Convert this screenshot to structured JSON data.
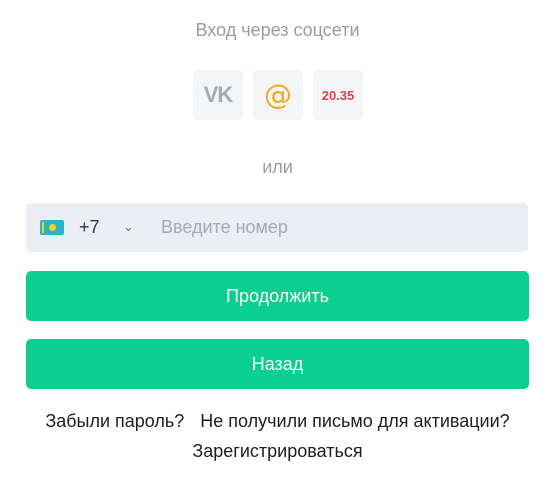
{
  "social": {
    "title": "Вход через соцсети",
    "buttons": [
      {
        "icon": "vk-icon",
        "label": "VK",
        "color": "#a4a9b3"
      },
      {
        "icon": "mail-at-icon",
        "label": "@",
        "color": "#f5a623"
      },
      {
        "icon": "news-2035-icon",
        "label": "20.35",
        "color": "#e2434b"
      }
    ]
  },
  "separator": "или",
  "phone": {
    "country_flag": "kazakhstan-flag-icon",
    "code": "+7",
    "chevron": "⌄",
    "placeholder": "Введите номер",
    "value": ""
  },
  "buttons": {
    "continue": "Продолжить",
    "back": "Назад",
    "accent_color": "#0bcf8f"
  },
  "links": {
    "forgot_password": "Забыли пароль?",
    "no_activation_email": "Не получили письмо для активации?",
    "register": "Зарегистрироваться"
  }
}
